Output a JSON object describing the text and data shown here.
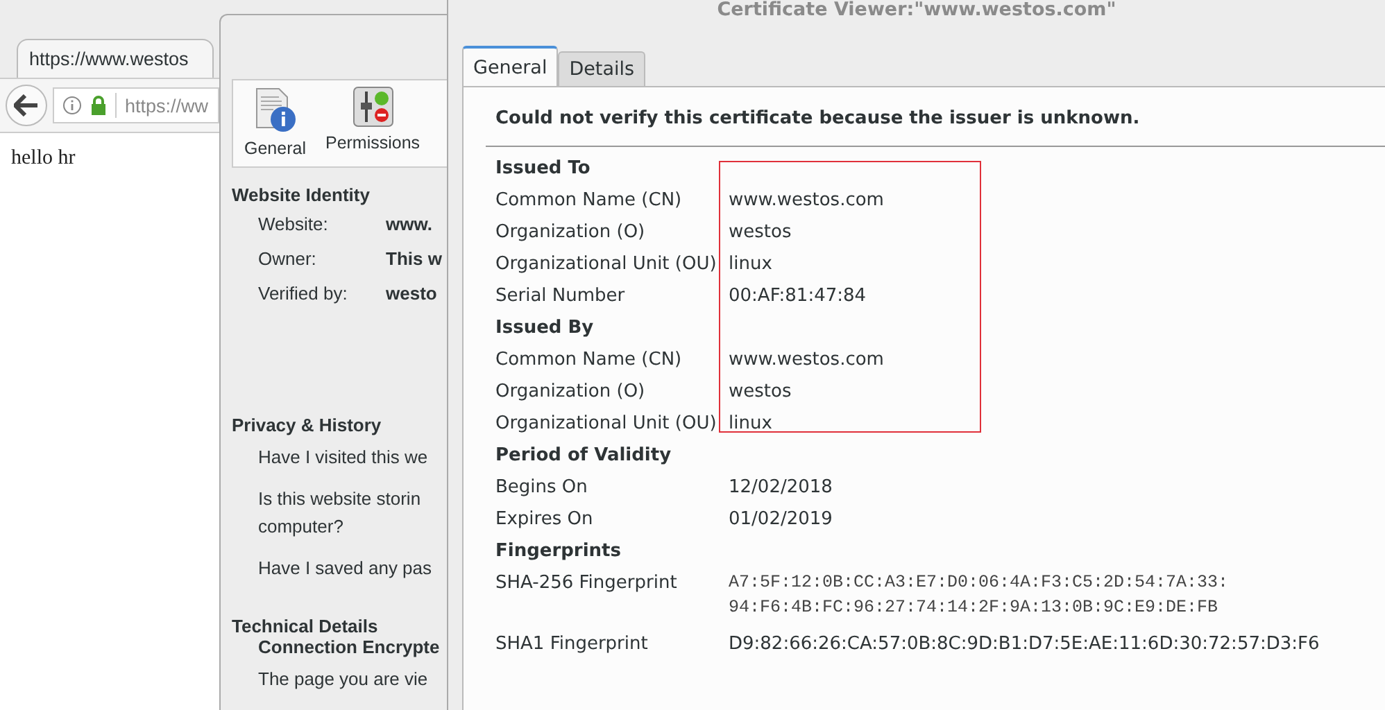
{
  "browser": {
    "tab_title": "https://www.westos",
    "url": "https://ww",
    "page_text": "hello hr"
  },
  "page_info": {
    "toolbar": [
      {
        "label": "General",
        "kind": "general"
      },
      {
        "label": "Permissions",
        "kind": "permissions"
      }
    ],
    "identity": {
      "heading": "Website Identity",
      "rows": [
        {
          "label": "Website:",
          "value": "www."
        },
        {
          "label": "Owner:",
          "value": "This w"
        },
        {
          "label": "Verified by:",
          "value": "westo"
        }
      ]
    },
    "privacy": {
      "heading": "Privacy & History",
      "items": [
        "Have I visited this we",
        "Is this website storin\ncomputer?",
        "Have I saved any pas"
      ]
    },
    "technical": {
      "heading": "Technical Details",
      "subheading": "Connection Encrypte",
      "lines": [
        "The page you are vie"
      ]
    }
  },
  "cert_viewer": {
    "title": "Certificate Viewer:\"www.westos.com\"",
    "tabs": [
      {
        "label": "General",
        "selected": true
      },
      {
        "label": "Details",
        "selected": false
      }
    ],
    "warning": "Could not verify this certificate because the issuer is unknown.",
    "sections": [
      {
        "heading": "Issued To",
        "fields": [
          {
            "label": "Common Name (CN)",
            "value": "www.westos.com"
          },
          {
            "label": "Organization (O)",
            "value": "westos"
          },
          {
            "label": "Organizational Unit (OU)",
            "value": "linux"
          },
          {
            "label": "Serial Number",
            "value": "00:AF:81:47:84"
          }
        ]
      },
      {
        "heading": "Issued By",
        "fields": [
          {
            "label": "Common Name (CN)",
            "value": "www.westos.com"
          },
          {
            "label": "Organization (O)",
            "value": "westos"
          },
          {
            "label": "Organizational Unit (OU)",
            "value": "linux"
          }
        ]
      },
      {
        "heading": "Period of Validity",
        "fields": [
          {
            "label": "Begins On",
            "value": "12/02/2018"
          },
          {
            "label": "Expires On",
            "value": "01/02/2019"
          }
        ]
      },
      {
        "heading": "Fingerprints",
        "fields": [
          {
            "label": "SHA-256 Fingerprint",
            "value": "A7:5F:12:0B:CC:A3:E7:D0:06:4A:F3:C5:2D:54:7A:33:\n94:F6:4B:FC:96:27:74:14:2F:9A:13:0B:9C:E9:DE:FB",
            "kind": "mono"
          },
          {
            "label": "SHA1 Fingerprint",
            "value": "D9:82:66:26:CA:57:0B:8C:9D:B1:D7:5E:AE:11:6D:30:72:57:D3:F6",
            "kind": "text"
          }
        ]
      }
    ]
  }
}
